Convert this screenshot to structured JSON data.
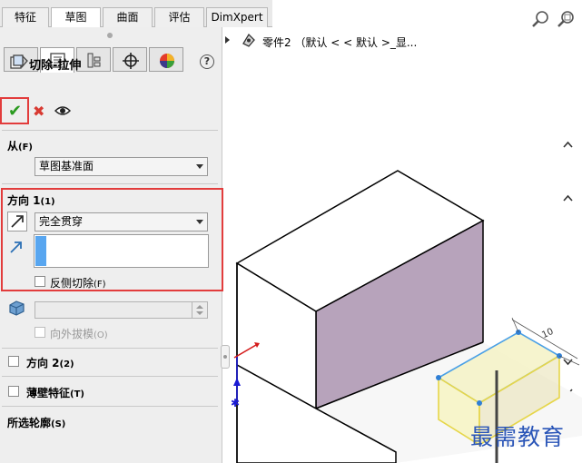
{
  "command_tabs": [
    "特征",
    "草图",
    "曲面",
    "评估",
    "DimXpert"
  ],
  "active_command_tab": "草图",
  "feature_tree": {
    "root_label": "零件2 （默认 < < 默认 >_显..."
  },
  "property_manager": {
    "title": "切除-拉伸",
    "help_label": "?",
    "ok_label": "✔",
    "cancel_label": "✖",
    "from": {
      "heading": "从",
      "shortcut": "(F)",
      "value": "草图基准面"
    },
    "direction1": {
      "heading": "方向 1",
      "shortcut": "(1)",
      "end_condition": "完全贯穿",
      "flip_side_label": "反侧切除",
      "flip_side_shortcut": "(F)",
      "draft_outward_label": "向外拔模",
      "draft_outward_shortcut": "(O)"
    },
    "direction2": {
      "heading": "方向 2",
      "shortcut": "(2)"
    },
    "thin_feature": {
      "heading": "薄壁特征",
      "shortcut": "(T)"
    },
    "selected_contours": {
      "heading": "所选轮廓",
      "shortcut": "(S)"
    }
  },
  "viewport": {
    "dimension_label": "10",
    "watermark": "最需教育"
  },
  "colors": {
    "highlight_red": "#e23c3c",
    "accept_green": "#2a9a1f",
    "face_purple": "#b7a3bb",
    "sketch_yellow": "#f4f2c6",
    "selection_blue": "#58a6f0"
  }
}
